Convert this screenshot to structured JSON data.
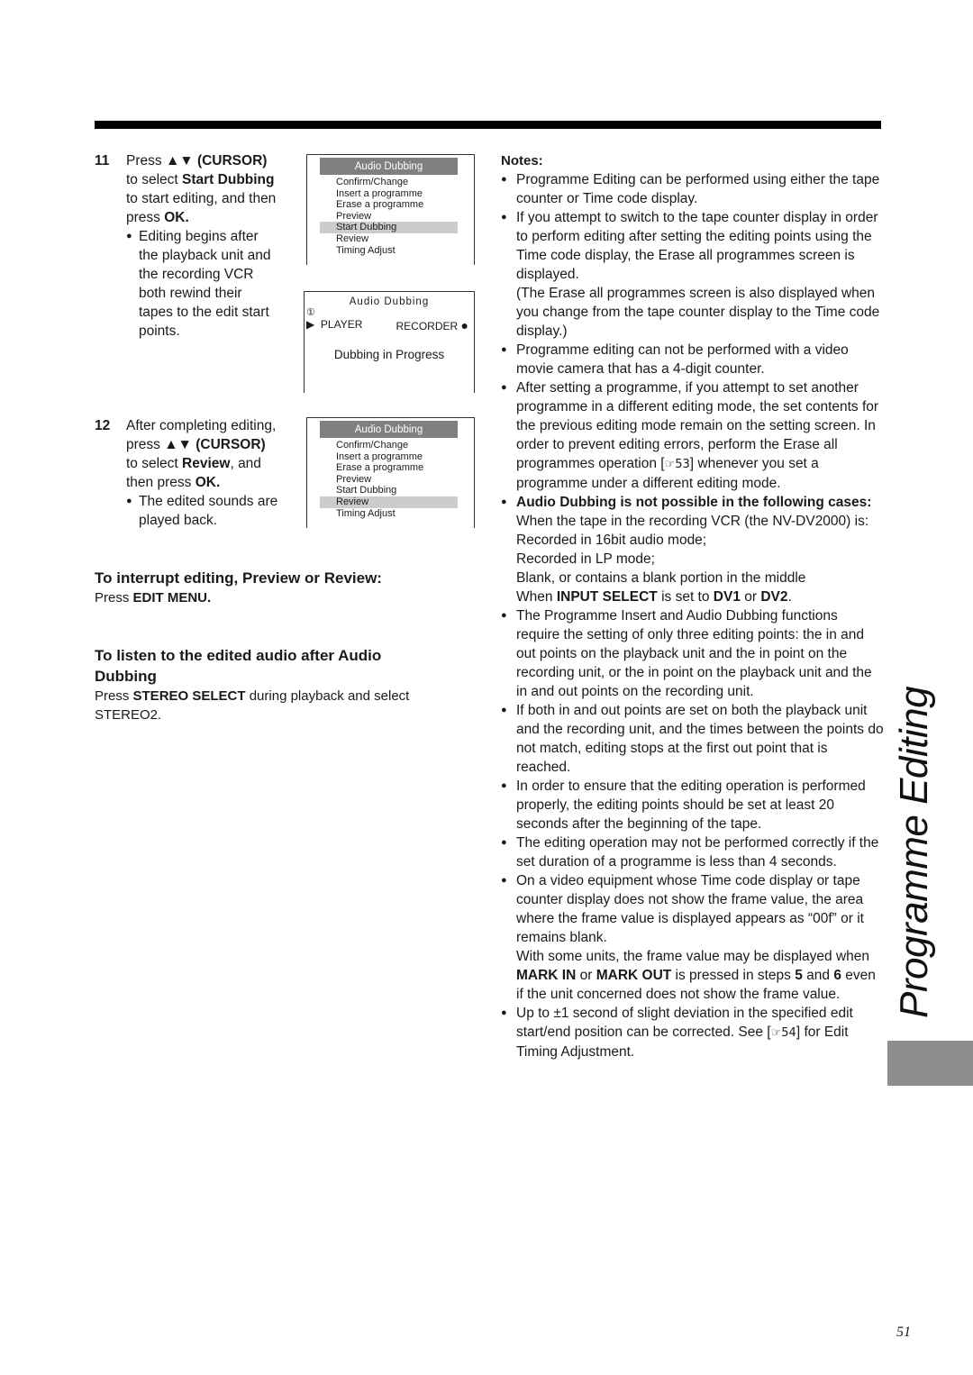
{
  "step11": {
    "number": "11",
    "line1_pre": "Press ",
    "arrows": "▲▼",
    "cursor": "(CURSOR)",
    "line2_pre": "to select ",
    "line2_bold": "Start Dubbing",
    "line3": "to start editing, and then",
    "line4_pre": "press ",
    "line4_bold": "OK.",
    "bullet_lines": [
      "Editing begins after",
      "the playback unit and",
      "the recording VCR",
      "both rewind their",
      "tapes to the edit start",
      "points."
    ]
  },
  "menu1": {
    "title": "Audio Dubbing",
    "items": [
      "Confirm/Change",
      "Insert a programme",
      "Erase a programme",
      "Preview",
      "Start Dubbing",
      "Review",
      "Timing Adjust"
    ],
    "selected": "Start Dubbing"
  },
  "screen": {
    "title": "Audio Dubbing",
    "circled": "①",
    "player_icon": "play-triangle-icon",
    "player": "PLAYER",
    "recorder": "RECORDER",
    "recorder_icon": "record-dot-icon",
    "status": "Dubbing in Progress"
  },
  "step12": {
    "number": "12",
    "line1": "After completing editing,",
    "line2_pre": "press ",
    "arrows": "▲▼",
    "cursor": "(CURSOR)",
    "line3_pre": "to select ",
    "line3_bold": "Review",
    "line3_post": ", and",
    "line4_pre": "then press ",
    "line4_bold": "OK.",
    "bullet_lines": [
      "The edited sounds are",
      "played back."
    ]
  },
  "menu2": {
    "title": "Audio Dubbing",
    "items": [
      "Confirm/Change",
      "Insert a programme",
      "Erase a programme",
      "Preview",
      "Start Dubbing",
      "Review",
      "Timing Adjust"
    ],
    "selected": "Review"
  },
  "interrupt": {
    "heading": "To interrupt editing, Preview or Review:",
    "text_pre": "Press ",
    "text_bold": "EDIT MENU."
  },
  "listen": {
    "heading_line1": "To listen to the edited audio after Audio",
    "heading_line2": "Dubbing",
    "text_pre": "Press ",
    "text_bold": "STEREO SELECT",
    "text_post": " during playback and select",
    "text_line2": "STEREO2."
  },
  "notes": {
    "title": "Notes:",
    "n1": "Programme Editing can be performed using either the tape counter or Time code display.",
    "n2": "If you attempt to switch to the tape counter display in order to perform editing after setting the editing points using the Time code display, the Erase all programmes screen is displayed.",
    "n2_sub": "(The Erase all programmes screen is also displayed when you change from the tape counter display to the Time code display.)",
    "n3": "Programme editing can not be performed with a video movie camera that has a 4-digit counter.",
    "n4_pre": "After setting a programme, if you attempt to set another programme in a different editing mode, the set contents for the previous editing mode remain on the setting screen.  In order to prevent editing errors, perform the Erase all programmes operation [",
    "n4_ref": "☞53",
    "n4_post": "] whenever you set a programme under a different editing mode.",
    "n5_bold": "Audio Dubbing is not possible in the following cases:",
    "n5_l1": "When the tape in the recording VCR (the NV-DV2000) is:",
    "n5_l2": "Recorded in 16bit audio mode;",
    "n5_l3": "Recorded in LP mode;",
    "n5_l4": "Blank, or contains a blank portion in the middle",
    "n5_l5_pre": "When ",
    "n5_l5_b1": "INPUT SELECT",
    "n5_l5_mid": " is set to ",
    "n5_l5_b2": "DV1",
    "n5_l5_or": " or ",
    "n5_l5_b3": "DV2",
    "n5_l5_end": ".",
    "n6": "The Programme Insert and Audio Dubbing functions require the setting of only three editing points: the in and out points on the playback unit and the in point on the recording unit, or the in point on the playback unit and the in and out points on the recording unit.",
    "n7": "If both in and out points are set on both the playback unit and the recording unit, and the times between the points do not match, editing stops at the first out point that is reached.",
    "n8": "In order to ensure that the editing operation is performed properly, the editing points should be set at least 20 seconds after the beginning of the tape.",
    "n9": "The editing operation may not be performed correctly if the set duration of a programme is less than 4 seconds.",
    "n10": "On a video equipment whose Time code display or tape counter display does not show the frame value, the area where the frame value is displayed appears as “00f” or it remains blank.",
    "n10_sub_pre": "With some units, the frame value may be displayed when ",
    "n10_sub_b1": "MARK IN",
    "n10_sub_or": " or ",
    "n10_sub_b2": "MARK OUT",
    "n10_sub_mid": " is pressed in steps ",
    "n10_sub_b3": "5",
    "n10_sub_and": " and ",
    "n10_sub_b4": "6",
    "n10_sub_end": " even if the unit concerned does not show the frame value.",
    "n11_pre": "Up to ±1 second of slight deviation in the specified edit start/end position can be corrected. See [",
    "n11_ref": "☞54",
    "n11_post": "] for Edit Timing Adjustment."
  },
  "side_title": "Programme Editing",
  "page_number": "51"
}
